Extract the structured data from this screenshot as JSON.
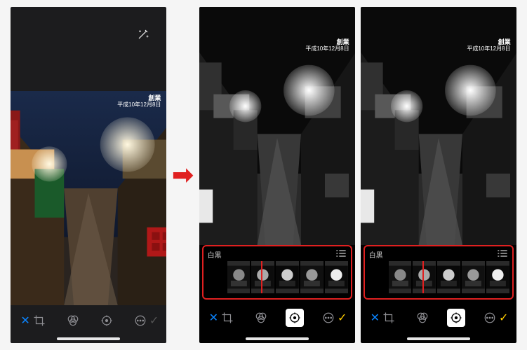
{
  "overlay": {
    "line1": "創業",
    "line2": "平成10年12月8日"
  },
  "filter": {
    "name": "白黒"
  },
  "toolbar": {
    "cancel": "✕",
    "confirm": "✓",
    "crop": "crop",
    "filters": "filters",
    "adjust": "adjust",
    "more": "more"
  },
  "colors": {
    "highlight": "#e02020",
    "confirmYellow": "#ffcc00",
    "cancelBlue": "#0a84ff"
  },
  "arrow": "➡"
}
